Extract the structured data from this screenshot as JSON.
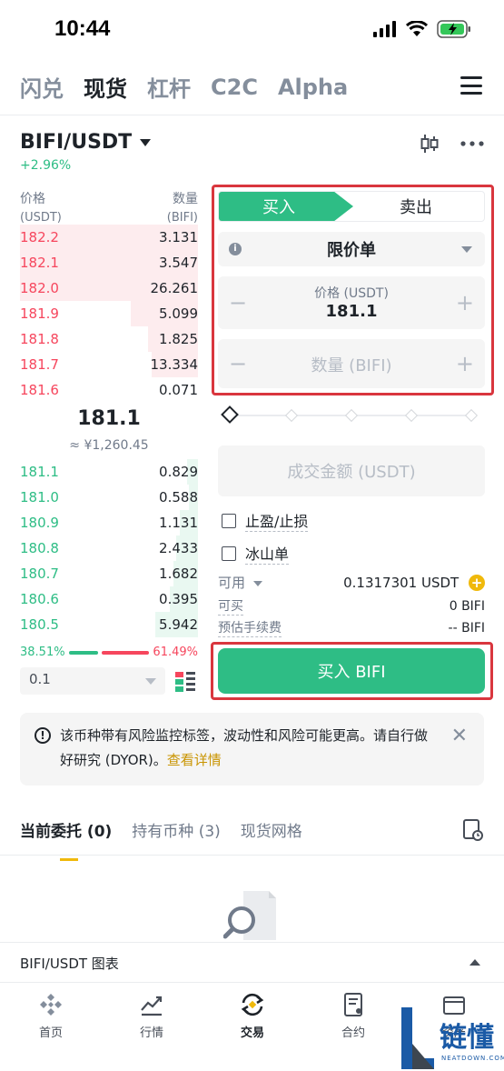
{
  "status_bar": {
    "time": "10:44"
  },
  "top_tabs": [
    "闪兑",
    "现货",
    "杠杆",
    "C2C",
    "Alpha"
  ],
  "pair": {
    "name": "BIFI/USDT",
    "change": "+2.96%"
  },
  "orderbook": {
    "price_label": "价格",
    "price_unit": "(USDT)",
    "qty_label": "数量",
    "qty_unit": "(BIFI)",
    "asks": [
      {
        "price": "182.2",
        "qty": "3.131",
        "depth": 1.0
      },
      {
        "price": "182.1",
        "qty": "3.547",
        "depth": 1.0
      },
      {
        "price": "182.0",
        "qty": "26.261",
        "depth": 1.0
      },
      {
        "price": "181.9",
        "qty": "5.099",
        "depth": 0.38
      },
      {
        "price": "181.8",
        "qty": "1.825",
        "depth": 0.28
      },
      {
        "price": "181.7",
        "qty": "13.334",
        "depth": 0.26
      },
      {
        "price": "181.6",
        "qty": "0.071",
        "depth": 0.0
      }
    ],
    "mid_price": "181.1",
    "mid_fiat": "≈ ¥1,260.45",
    "bids": [
      {
        "price": "181.1",
        "qty": "0.829",
        "depth": 0.06
      },
      {
        "price": "181.0",
        "qty": "0.588",
        "depth": 0.05
      },
      {
        "price": "180.9",
        "qty": "1.131",
        "depth": 0.1
      },
      {
        "price": "180.8",
        "qty": "2.433",
        "depth": 0.12
      },
      {
        "price": "180.7",
        "qty": "1.682",
        "depth": 0.14
      },
      {
        "price": "180.6",
        "qty": "0.395",
        "depth": 0.16
      },
      {
        "price": "180.5",
        "qty": "5.942",
        "depth": 0.24
      }
    ],
    "buy_ratio": "38.51%",
    "sell_ratio": "61.49%",
    "buy_ratio_value": 0.3851,
    "depth_value": "0.1"
  },
  "order_form": {
    "buy_label": "买入",
    "sell_label": "卖出",
    "order_type": "限价单",
    "price_label": "价格 (USDT)",
    "price_value": "181.1",
    "qty_placeholder": "数量 (BIFI)",
    "total_placeholder": "成交金额 (USDT)",
    "tpsl_label": "止盈/止损",
    "iceberg_label": "冰山单",
    "available_label": "可用",
    "available_value": "0.1317301 USDT",
    "can_buy_label": "可买",
    "can_buy_value": "0 BIFI",
    "fee_label": "预估手续费",
    "fee_value": "-- BIFI",
    "submit_label": "买入 BIFI"
  },
  "notice": {
    "text": "该币种带有风险监控标签，波动性和风险可能更高。请自行做好研究 (DYOR)。",
    "link": "查看详情"
  },
  "bottom_tabs": [
    "当前委托 (0)",
    "持有币种 (3)",
    "现货网格"
  ],
  "chart_bar": "BIFI/USDT 图表",
  "nav": [
    "首页",
    "行情",
    "交易",
    "合约",
    "资产"
  ],
  "watermark": {
    "text": "链懂",
    "sub": "NEATDOWN.COM"
  },
  "colors": {
    "green": "#2ebd85",
    "red": "#f6465d",
    "yellow": "#f0b90b",
    "highlight": "#d9363e"
  }
}
